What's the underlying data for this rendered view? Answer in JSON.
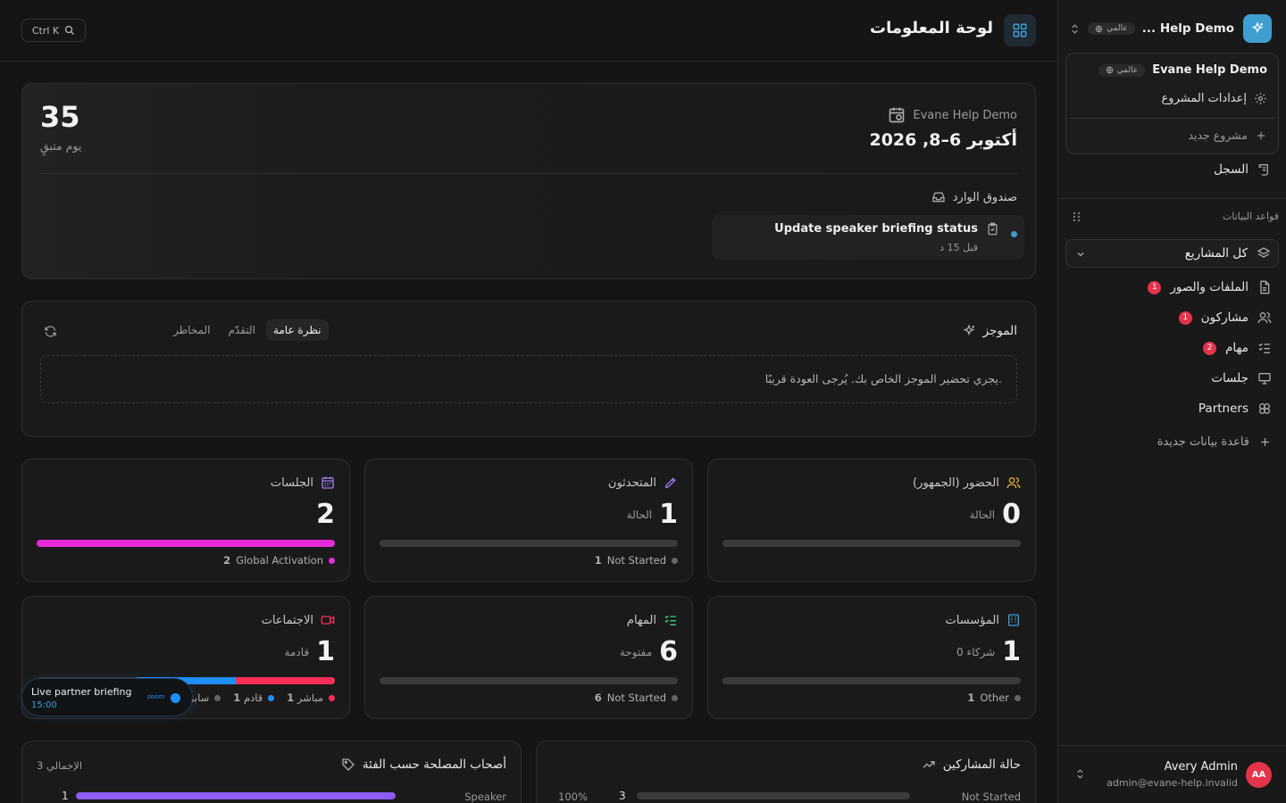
{
  "topbar": {
    "shortcut": "Ctrl K",
    "title": "لوحة المعلومات"
  },
  "hero": {
    "days_left": "35",
    "days_label": "يوم متبقٍ",
    "event_name": "Evane Help Demo",
    "event_dates": "أكتوبر 6–8, 2026",
    "inbox_label": "صندوق الوارد",
    "inbox_item": {
      "title": "Update speaker briefing status",
      "time": "قبل 15 د"
    }
  },
  "brief": {
    "title": "الموجز",
    "tabs": [
      "نظرة عامة",
      "التقدّم",
      "المخاطر"
    ],
    "message": "يجري تحضير الموجز الخاص بك. يُرجى العودة قريبًا."
  },
  "stats": {
    "attendance": {
      "title": "الحضور (الجمهور)",
      "value": "0",
      "sub": "الحالة"
    },
    "speakers": {
      "title": "المتحدثون",
      "value": "1",
      "sub": "الحالة",
      "legend_count": "1",
      "legend_label": "Not Started"
    },
    "sessions": {
      "title": "الجلسات",
      "value": "2",
      "legend_count": "2",
      "legend_label": "Global Activation",
      "progress": 1.0
    },
    "orgs": {
      "title": "المؤسسات",
      "value": "1",
      "sub": "0 شركاء",
      "legend_count": "1",
      "legend_label": "Other"
    },
    "tasks": {
      "title": "المهام",
      "value": "6",
      "sub": "مفتوحة",
      "legend_count": "6",
      "legend_label": "Not Started"
    },
    "meetings": {
      "title": "الاجتماعات",
      "value": "1",
      "sub": "قادمة",
      "legend": [
        {
          "count": "1",
          "label": "مباشر"
        },
        {
          "count": "1",
          "label": "قادم"
        },
        {
          "count": "",
          "label": "سابق"
        }
      ]
    }
  },
  "toast": {
    "title": "Live partner briefing",
    "time": "15:00",
    "brand": "zoom"
  },
  "bottom": {
    "stakeholders": {
      "title": "أصحاب المصلحة حسب الفئة",
      "total": "3 الإجمالي",
      "row_label": "Speaker",
      "row_value": "1"
    },
    "participants": {
      "title": "حالة المشاركين",
      "row_label": "Not Started",
      "row_value": "3",
      "row_pct": "100%"
    }
  },
  "sidebar": {
    "workspace": "Help Demo ...",
    "workspace_tag": "عالمي",
    "dropdown": {
      "project": "Evane Help Demo",
      "project_tag": "عالمي",
      "settings": "إعدادات المشروع",
      "new_project": "مشروع جديد"
    },
    "log": "السجل",
    "section": "قواعد البيانات",
    "all_projects": "كل المشاريع",
    "items": [
      {
        "label": "الملفات والصور",
        "badge": "1"
      },
      {
        "label": "مشاركون",
        "badge": "1"
      },
      {
        "label": "مهام",
        "badge": "2"
      },
      {
        "label": "جلسات",
        "badge": ""
      },
      {
        "label": "Partners",
        "badge": ""
      }
    ],
    "new_db": "قاعدة بيانات جديدة",
    "user": {
      "name": "Avery Admin",
      "email": "admin@evane-help.invalid",
      "initials": "AA"
    }
  },
  "colors": {
    "magenta": "#e52bd8",
    "blue": "#1f8fff",
    "red": "#ff2e57",
    "accent": "#3f9ed0"
  }
}
